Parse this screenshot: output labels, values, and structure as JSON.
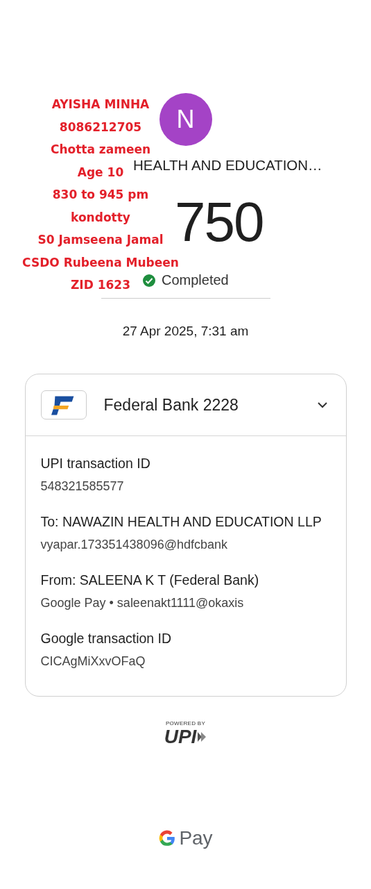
{
  "payee": {
    "avatar_letter": "N",
    "title": "HEALTH AND EDUCATION…",
    "amount": "750",
    "status": "Completed",
    "date": "27 Apr 2025, 7:31 am"
  },
  "annotation": {
    "lines": [
      "AYISHA MINHA",
      "8086212705",
      "Chotta zameen",
      "Age 10",
      "830 to 945 pm",
      "kondotty",
      "S0 Jamseena Jamal",
      "CSDO Rubeena Mubeen",
      "ZID 1623"
    ]
  },
  "account": {
    "name": "Federal Bank 2228",
    "expanded": true
  },
  "details": [
    {
      "label": "UPI transaction ID",
      "values": [
        "548321585577"
      ]
    },
    {
      "label": "To: NAWAZIN HEALTH AND EDUCATION LLP",
      "values": [
        "vyapar.173351438096@hdfcbank"
      ]
    },
    {
      "label": "From: SALEENA K T (Federal Bank)",
      "values": [
        "Google Pay • saleenakt1111@okaxis"
      ]
    },
    {
      "label": "Google transaction ID",
      "values": [
        "CICAgMiXxvOFaQ"
      ]
    }
  ],
  "footer": {
    "powered_by": "POWERED BY",
    "upi": "UPI",
    "brand": "Pay"
  }
}
